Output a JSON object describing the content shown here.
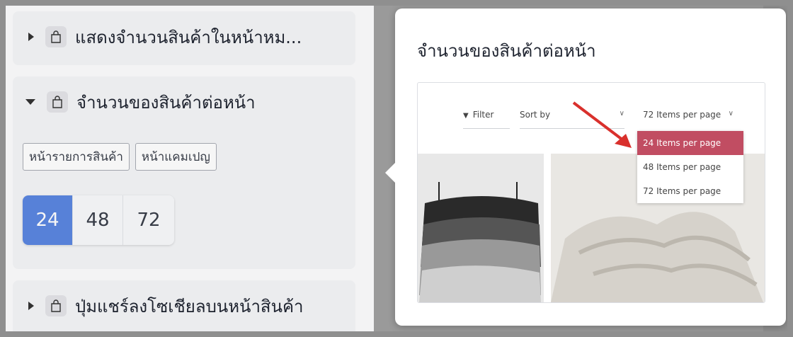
{
  "left": {
    "cards": [
      {
        "title": "แสดงจำนวนสินค้าในหน้าหม...",
        "expanded": false,
        "icon": "shopping-bag-icon"
      },
      {
        "title": "จำนวนของสินค้าต่อหน้า",
        "expanded": true,
        "icon": "shopping-bag-icon",
        "tags": [
          "หน้ารายการสินค้า",
          "หน้าแคมเปญ"
        ],
        "options": [
          "24",
          "48",
          "72"
        ],
        "selected": "24"
      },
      {
        "title": "ปุ่มแชร์ลงโซเชียลบนหน้าสินค้า",
        "expanded": false,
        "icon": "shopping-bag-icon"
      }
    ]
  },
  "popover": {
    "title": "จำนวนของสินค้าต่อหน้า",
    "preview": {
      "filter_label": "Filter",
      "sort_label": "Sort by",
      "items_label": "72 Items per page",
      "menu_options": [
        "24 Items per page",
        "48 Items per page",
        "72 Items per page"
      ],
      "menu_selected": "24 Items per page"
    }
  },
  "colors": {
    "accent": "#5b86e0",
    "highlight": "#c14d62",
    "arrow": "#d9302c"
  }
}
